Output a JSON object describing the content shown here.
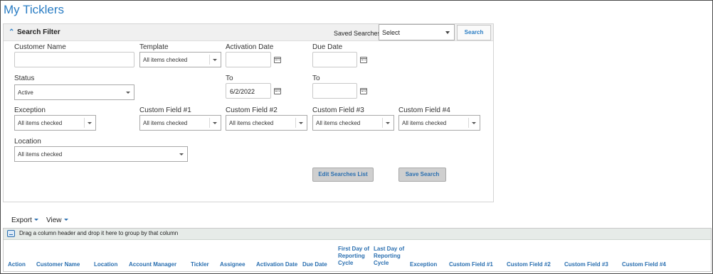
{
  "page": {
    "title": "My Ticklers"
  },
  "filter": {
    "title": "Search Filter",
    "saved_searches_label": "Saved Searches",
    "saved_searches_value": "Select",
    "search_button": "Search",
    "fields": {
      "customer_name": {
        "label": "Customer Name",
        "value": ""
      },
      "template": {
        "label": "Template",
        "value": "All items checked"
      },
      "activation_date": {
        "label": "Activation Date",
        "value": ""
      },
      "due_date": {
        "label": "Due Date",
        "value": ""
      },
      "status": {
        "label": "Status",
        "value": "Active"
      },
      "activation_to": {
        "label": "To",
        "value": "6/2/2022"
      },
      "due_to": {
        "label": "To",
        "value": ""
      },
      "exception": {
        "label": "Exception",
        "value": "All items checked"
      },
      "custom1": {
        "label": "Custom Field #1",
        "value": "All items checked"
      },
      "custom2": {
        "label": "Custom Field #2",
        "value": "All items checked"
      },
      "custom3": {
        "label": "Custom Field #3",
        "value": "All items checked"
      },
      "custom4": {
        "label": "Custom Field #4",
        "value": "All items checked"
      },
      "location": {
        "label": "Location",
        "value": "All items checked"
      }
    },
    "edit_searches_button": "Edit Searches List",
    "save_search_button": "Save Search"
  },
  "toolbar": {
    "export_label": "Export",
    "view_label": "View"
  },
  "grid": {
    "group_hint": "Drag a column header and drop it here to group by that column",
    "columns": [
      "Action",
      "Customer Name",
      "Location",
      "Account Manager",
      "Tickler",
      "Assignee",
      "Activation Date",
      "Due Date",
      "First Day of Reporting Cycle",
      "Last Day of Reporting Cycle",
      "Exception",
      "Custom Field #1",
      "Custom Field #2",
      "Custom Field #3",
      "Custom Field #4"
    ]
  },
  "colors": {
    "title_blue": "#2a7dc4",
    "link_blue": "#2a6fb0",
    "button_gray": "#cfcfcf"
  },
  "icons": [
    "chevron-up-icon",
    "caret-down-icon",
    "calendar-icon",
    "group-panel-icon"
  ]
}
